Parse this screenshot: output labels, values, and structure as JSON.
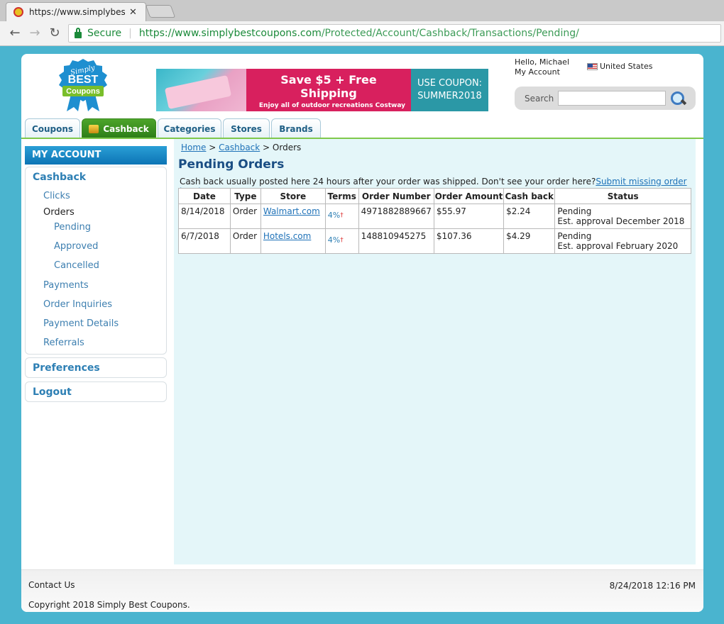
{
  "browser": {
    "tab_title": "https://www.simplybestcc",
    "secure_label": "Secure",
    "url_host": "https://www.simplybestcoupons.com",
    "url_path": "/Protected/Account/Cashback/Transactions/Pending/"
  },
  "header": {
    "logo": {
      "line1": "Simply",
      "line2": "BEST",
      "line3": "Coupons"
    },
    "banner": {
      "headline": "Save $5 + Free Shipping",
      "sub": "Enjoy all of outdoor recreations Costway can offer and help you adventure this SUMMER!",
      "coupon_line1": "USE COUPON:",
      "coupon_line2": "SUMMER2018"
    },
    "hello": "Hello, Michael",
    "my_account": "My Account",
    "country": "United States",
    "search_label": "Search"
  },
  "tabs": [
    "Coupons",
    "Cashback",
    "Categories",
    "Stores",
    "Brands"
  ],
  "sidebar": {
    "heading": "MY ACCOUNT",
    "cashback": "Cashback",
    "clicks": "Clicks",
    "orders": "Orders",
    "pending": "Pending",
    "approved": "Approved",
    "cancelled": "Cancelled",
    "payments": "Payments",
    "order_inquiries": "Order Inquiries",
    "payment_details": "Payment Details",
    "referrals": "Referrals",
    "preferences": "Preferences",
    "logout": "Logout"
  },
  "content": {
    "breadcrumb": {
      "home": "Home",
      "sep1": " > ",
      "cashback": "Cashback",
      "sep2": " > ",
      "current": "Orders"
    },
    "title": "Pending Orders",
    "notice": "Cash back usually posted here 24 hours after your order was shipped. Don't see your order here?",
    "notice_link": "Submit missing order inquiry.",
    "columns": [
      "Date",
      "Type",
      "Store",
      "Terms",
      "Order Number",
      "Order Amount",
      "Cash back",
      "Status"
    ],
    "rows": [
      {
        "date": "8/14/2018",
        "type": "Order",
        "store": "Walmart.com",
        "terms": "4%",
        "order_number": "4971882889667",
        "amount": "$55.97",
        "cashback": "$2.24",
        "status": "Pending",
        "approval": "Est. approval December 2018"
      },
      {
        "date": "6/7/2018",
        "type": "Order",
        "store": "Hotels.com",
        "terms": "4%",
        "order_number": "148810945275",
        "amount": "$107.36",
        "cashback": "$4.29",
        "status": "Pending",
        "approval": "Est. approval February 2020"
      }
    ],
    "terms_mark": "†"
  },
  "footer": {
    "contact": "Contact Us",
    "timestamp": "8/24/2018 12:16 PM",
    "copyright": "Copyright 2018 Simply Best Coupons."
  }
}
